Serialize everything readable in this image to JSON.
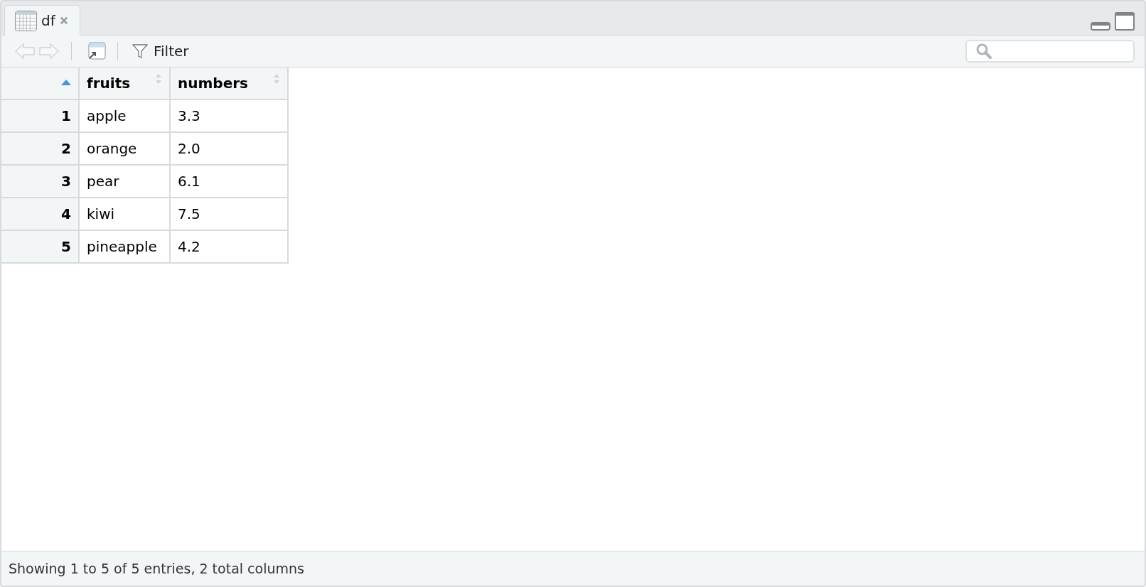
{
  "tabs": [
    {
      "label": "df",
      "selected": true,
      "closable": true
    }
  ],
  "toolbar": {
    "back_disabled": true,
    "forward_disabled": true,
    "filter_label": "Filter"
  },
  "table": {
    "columns": [
      {
        "sorted_ascending": true
      },
      {
        "label": "fruits",
        "sorted_ascending": false
      },
      {
        "label": "numbers",
        "sorted_ascending": false
      }
    ],
    "rows": [
      [
        "1",
        "apple",
        "3.3"
      ],
      [
        "2",
        "orange",
        "2.0"
      ],
      [
        "3",
        "pear",
        "6.1"
      ],
      [
        "4",
        "kiwi",
        "7.5"
      ],
      [
        "5",
        "pineapple",
        "4.2"
      ]
    ]
  },
  "status_bar": "Showing 1 to 5 of 5 entries, 2 total columns"
}
